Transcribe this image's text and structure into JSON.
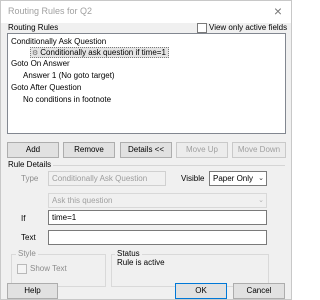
{
  "window": {
    "title": "Routing Rules for Q2",
    "close_icon": "close-icon"
  },
  "routing_rules": {
    "label": "Routing Rules",
    "active_only_label": "View only active fields",
    "active_only_checked": false,
    "tree": [
      {
        "label": "Conditionally Ask Question",
        "level": 0
      },
      {
        "label": "Conditionally ask question if time=1",
        "level": 1,
        "selected": true,
        "icon": "rule-icon"
      },
      {
        "label": "Goto On Answer",
        "level": 0
      },
      {
        "label": "Answer 1 (No goto target)",
        "level": 1
      },
      {
        "label": "Goto After Question",
        "level": 0
      },
      {
        "label": "No conditions in footnote",
        "level": 1
      }
    ]
  },
  "toolbar": {
    "add": "Add",
    "remove": "Remove",
    "details": "Details <<",
    "move_up": "Move Up",
    "move_down": "Move Down"
  },
  "rule_details": {
    "label": "Rule Details",
    "type_label": "Type",
    "type_value": "Conditionally Ask Question",
    "visible_label": "Visible",
    "visible_value": "Paper Only",
    "action_value": "Ask this question",
    "if_label": "If",
    "if_value": "time=1",
    "text_label": "Text",
    "text_value": ""
  },
  "style": {
    "label": "Style",
    "show_text_label": "Show Text",
    "show_text_checked": false
  },
  "status": {
    "label": "Status",
    "text": "Rule is active"
  },
  "footer": {
    "help": "Help",
    "ok": "OK",
    "cancel": "Cancel"
  }
}
